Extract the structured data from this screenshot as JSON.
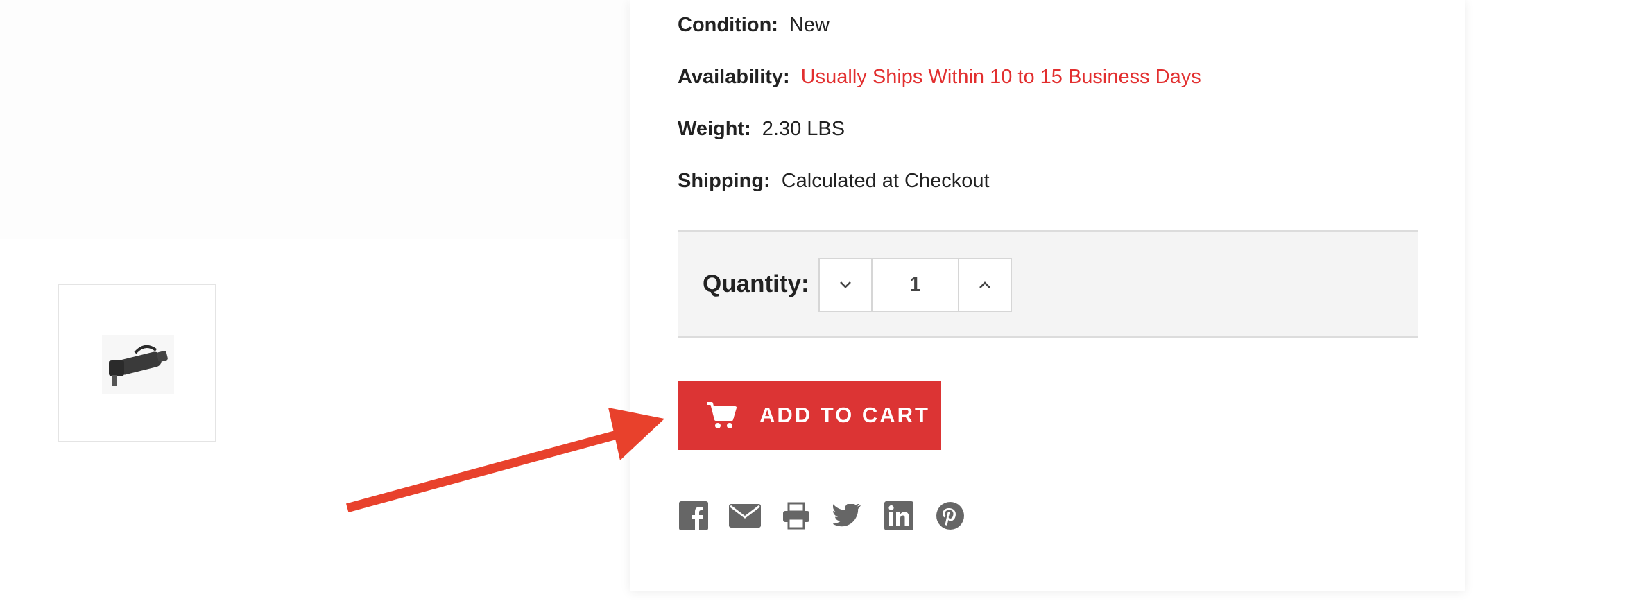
{
  "product": {
    "thumbnail_icon": "angle-die-grinder-thumbnail",
    "specs": [
      {
        "label": "Condition:",
        "value": "New"
      },
      {
        "label": "Availability:",
        "value": "Usually Ships Within 10 to 15 Business Days"
      },
      {
        "label": "Weight:",
        "value": "2.30 LBS"
      },
      {
        "label": "Shipping:",
        "value": "Calculated at Checkout"
      }
    ]
  },
  "quantity": {
    "label": "Quantity:",
    "value": "1",
    "decrement_icon": "chevron-down-icon",
    "increment_icon": "chevron-up-icon"
  },
  "cart": {
    "button_label": "ADD TO CART",
    "icon": "shopping-cart-icon"
  },
  "share": [
    "facebook-icon",
    "email-icon",
    "print-icon",
    "twitter-icon",
    "linkedin-icon",
    "pinterest-icon"
  ],
  "annotation": {
    "icon": "red-arrow-pointer"
  },
  "colors": {
    "accent_red": "#dc3434",
    "availability_red": "#e22f2f",
    "annotation_arrow": "#e8412c",
    "icon_gray": "#666666"
  }
}
